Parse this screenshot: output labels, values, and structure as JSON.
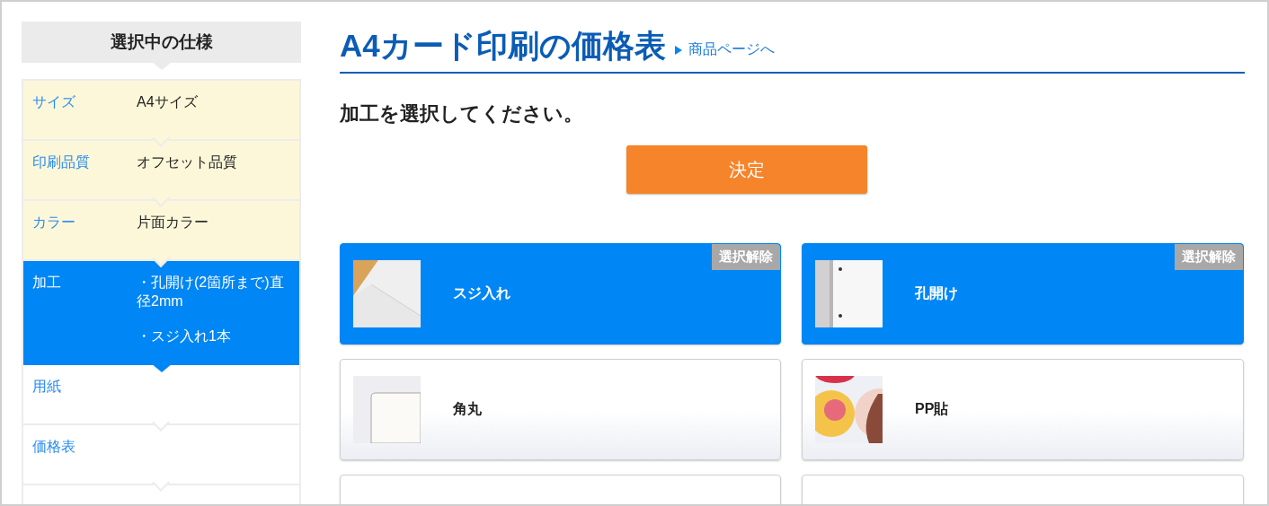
{
  "sidebar": {
    "title": "選択中の仕様",
    "rows": [
      {
        "label": "サイズ",
        "values": [
          "A4サイズ"
        ],
        "completed": true,
        "selected": false
      },
      {
        "label": "印刷品質",
        "values": [
          "オフセット品質"
        ],
        "completed": true,
        "selected": false
      },
      {
        "label": "カラー",
        "values": [
          "片面カラー"
        ],
        "completed": true,
        "selected": false
      },
      {
        "label": "加工",
        "values": [
          "・孔開け(2箇所まで)直径2mm",
          "・スジ入れ1本"
        ],
        "selected": true
      },
      {
        "label": "用紙",
        "values": [],
        "completed": false,
        "selected": false
      },
      {
        "label": "価格表",
        "values": [],
        "completed": false,
        "selected": false
      }
    ]
  },
  "heading": {
    "title": "A4カード印刷の価格表",
    "link": "商品ページへ"
  },
  "prompt": "加工を選択してください。",
  "confirm_button": "決定",
  "options": [
    {
      "name": "スジ入れ",
      "selected": true,
      "badge": "選択解除",
      "kind": "crease"
    },
    {
      "name": "孔開け",
      "selected": true,
      "badge": "選択解除",
      "kind": "holes"
    },
    {
      "name": "角丸",
      "selected": false,
      "kind": "corner"
    },
    {
      "name": "PP貼",
      "selected": false,
      "kind": "laminate"
    }
  ]
}
